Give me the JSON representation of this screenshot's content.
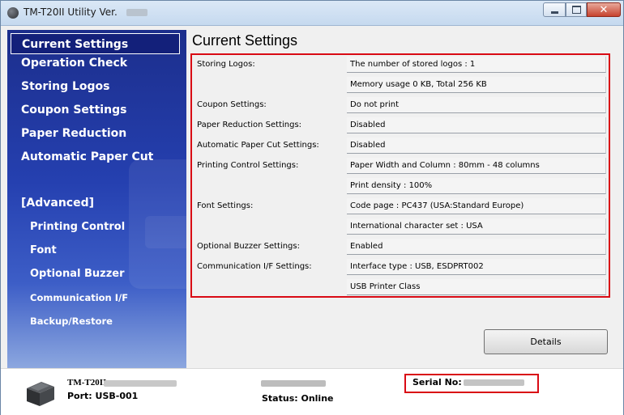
{
  "window": {
    "title": "TM-T20II Utility Ver.",
    "controls": {
      "minimize_icon": "minimize-icon",
      "maximize_icon": "maximize-icon",
      "close_icon": "close-icon",
      "close_glyph": "✕"
    }
  },
  "sidebar": {
    "items": [
      {
        "label": "Current Settings",
        "active": true
      },
      {
        "label": "Operation Check"
      },
      {
        "label": "Storing Logos"
      },
      {
        "label": "Coupon Settings"
      },
      {
        "label": "Paper Reduction"
      },
      {
        "label": "Automatic Paper Cut"
      }
    ],
    "advanced_header": "[Advanced]",
    "advanced_items": [
      {
        "label": "Printing Control"
      },
      {
        "label": "Font"
      },
      {
        "label": "Optional Buzzer"
      },
      {
        "label": "Communication I/F"
      },
      {
        "label": "Backup/Restore"
      }
    ]
  },
  "main": {
    "title": "Current Settings",
    "rows": [
      {
        "label": "Storing Logos:",
        "value": "The number of stored logos : 1"
      },
      {
        "label": "",
        "value": "Memory usage 0 KB, Total 256 KB"
      },
      {
        "label": "Coupon Settings:",
        "value": "Do not print"
      },
      {
        "label": "Paper Reduction Settings:",
        "value": "Disabled"
      },
      {
        "label": "Automatic Paper Cut Settings:",
        "value": "Disabled"
      },
      {
        "label": "Printing Control Settings:",
        "value": "Paper Width and Column : 80mm - 48 columns"
      },
      {
        "label": "",
        "value": "Print density : 100%"
      },
      {
        "label": "Font Settings:",
        "value": "Code page : PC437 (USA:Standard Europe)"
      },
      {
        "label": "",
        "value": "International character set : USA"
      },
      {
        "label": "Optional Buzzer Settings:",
        "value": "Enabled"
      },
      {
        "label": "Communication I/F Settings:",
        "value": "Interface type : USB, ESDPRT002"
      },
      {
        "label": "",
        "value": "USB Printer Class"
      }
    ],
    "details_button": "Details"
  },
  "footer": {
    "model": "TM-T20II",
    "port": "Port: USB-001",
    "status": "Status: Online",
    "serial_label": "Serial No:",
    "printer_icon": "printer-icon"
  },
  "colors": {
    "sidebar_top": "#1c2e8c",
    "highlight_border": "#d90a14",
    "active_item_bg": "#13207a"
  }
}
